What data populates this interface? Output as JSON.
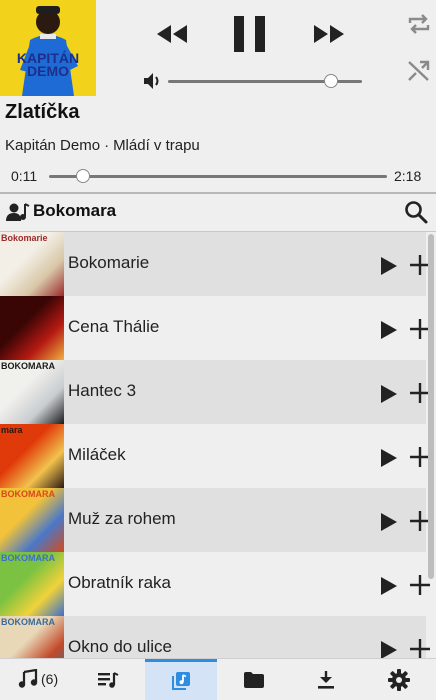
{
  "cover": {
    "lines": [
      "KAPITÁN",
      "DEMO"
    ],
    "colors": {
      "bg": "#f2d21a",
      "text": "#1c2f8c",
      "figure": "#1e6bd6"
    }
  },
  "player": {
    "title": "Zlatíčka",
    "artist": "Kapitán Demo",
    "separator": "·",
    "album": "Mládí v trapu",
    "elapsed": "0:11",
    "total": "2:18",
    "progress": 0.08,
    "volume": 0.84,
    "controls": [
      "previous-icon",
      "pause-icon",
      "next-icon"
    ],
    "toggles": [
      "repeat-icon",
      "shuffle-icon"
    ]
  },
  "artist_bar": {
    "name": "Bokomara",
    "icons": [
      "artist-icon",
      "search-icon"
    ]
  },
  "albums": [
    {
      "title": "Bokomarie",
      "cover_text": "Bokomarie",
      "colors": [
        "#f3efe7",
        "#d8c7a8",
        "#9a2a2a"
      ]
    },
    {
      "title": "Cena Thálie",
      "cover_text": "",
      "colors": [
        "#3a0505",
        "#b51a12",
        "#f0b040"
      ]
    },
    {
      "title": "Hantec 3",
      "cover_text": "BOKOMARA",
      "colors": [
        "#f0f0ec",
        "#c9cdd0",
        "#1a1a1a"
      ]
    },
    {
      "title": "Miláček",
      "cover_text": "mara",
      "colors": [
        "#e03a0a",
        "#f2c14e",
        "#2a1a14"
      ]
    },
    {
      "title": "Muž za rohem",
      "cover_text": "BOKOMARA",
      "colors": [
        "#f1c23a",
        "#4a78c8",
        "#d64a1a"
      ]
    },
    {
      "title": "Obratník raka",
      "cover_text": "BOKOMARA",
      "colors": [
        "#7cc242",
        "#f0d23a",
        "#3a6ed0"
      ]
    },
    {
      "title": "Okno do ulice",
      "cover_text": "BOKOMARA",
      "colors": [
        "#e8d8b8",
        "#c24a2a",
        "#3a6a9a"
      ]
    }
  ],
  "nav": {
    "tabs": [
      {
        "icon": "music-note-icon",
        "label": "(6)"
      },
      {
        "icon": "playlist-icon",
        "label": ""
      },
      {
        "icon": "library-icon",
        "label": "",
        "active": true
      },
      {
        "icon": "folder-icon",
        "label": ""
      },
      {
        "icon": "download-icon",
        "label": ""
      },
      {
        "icon": "settings-icon",
        "label": ""
      }
    ],
    "active_color": "#2e8de0"
  }
}
